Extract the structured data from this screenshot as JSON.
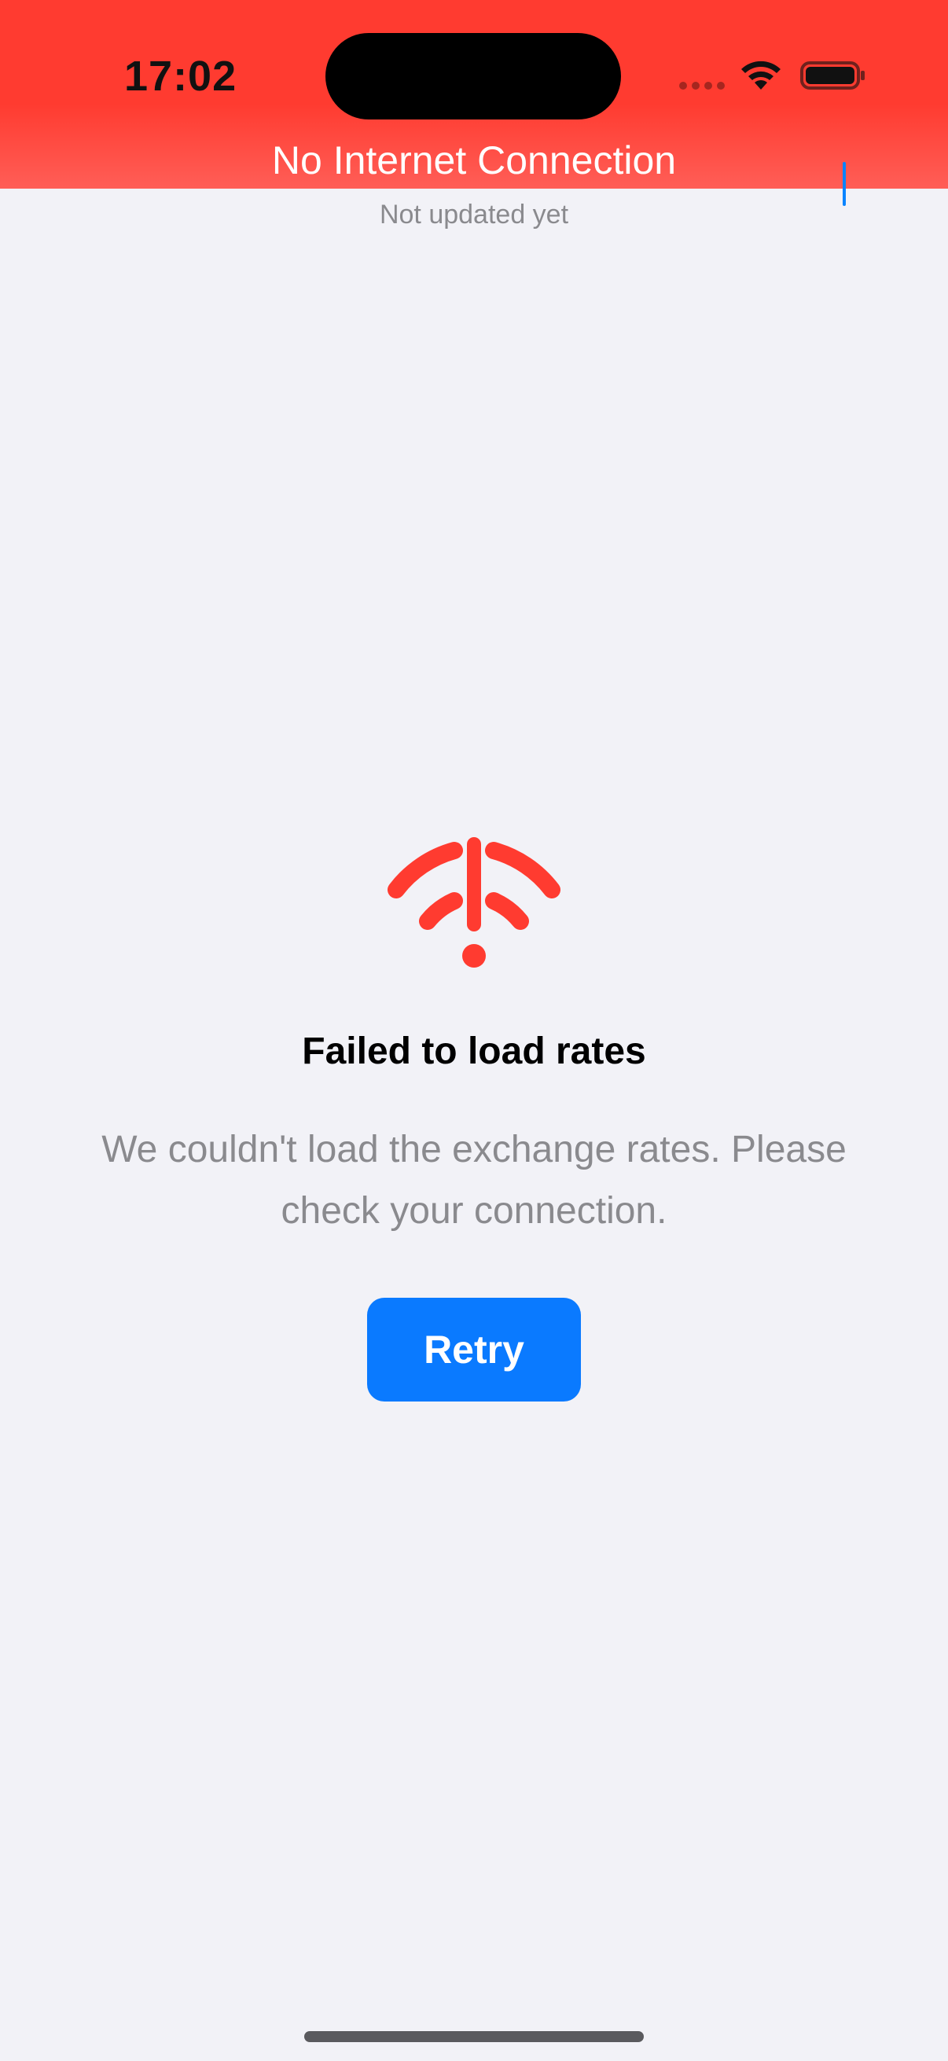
{
  "status_bar": {
    "time": "17:02"
  },
  "banner": {
    "text": "No Internet Connection",
    "color": "#ff3b30"
  },
  "nav": {
    "subtitle": "Not updated yet",
    "add_icon": "plus-icon"
  },
  "error": {
    "icon": "wifi-exclamation-icon",
    "title": "Failed to load rates",
    "message": "We couldn't load the exchange rates. Please check your connection.",
    "retry_label": "Retry"
  },
  "colors": {
    "accent": "#0a7aff",
    "error": "#ff3b30",
    "background": "#f2f2f7",
    "secondary_text": "#8a8a8e"
  }
}
